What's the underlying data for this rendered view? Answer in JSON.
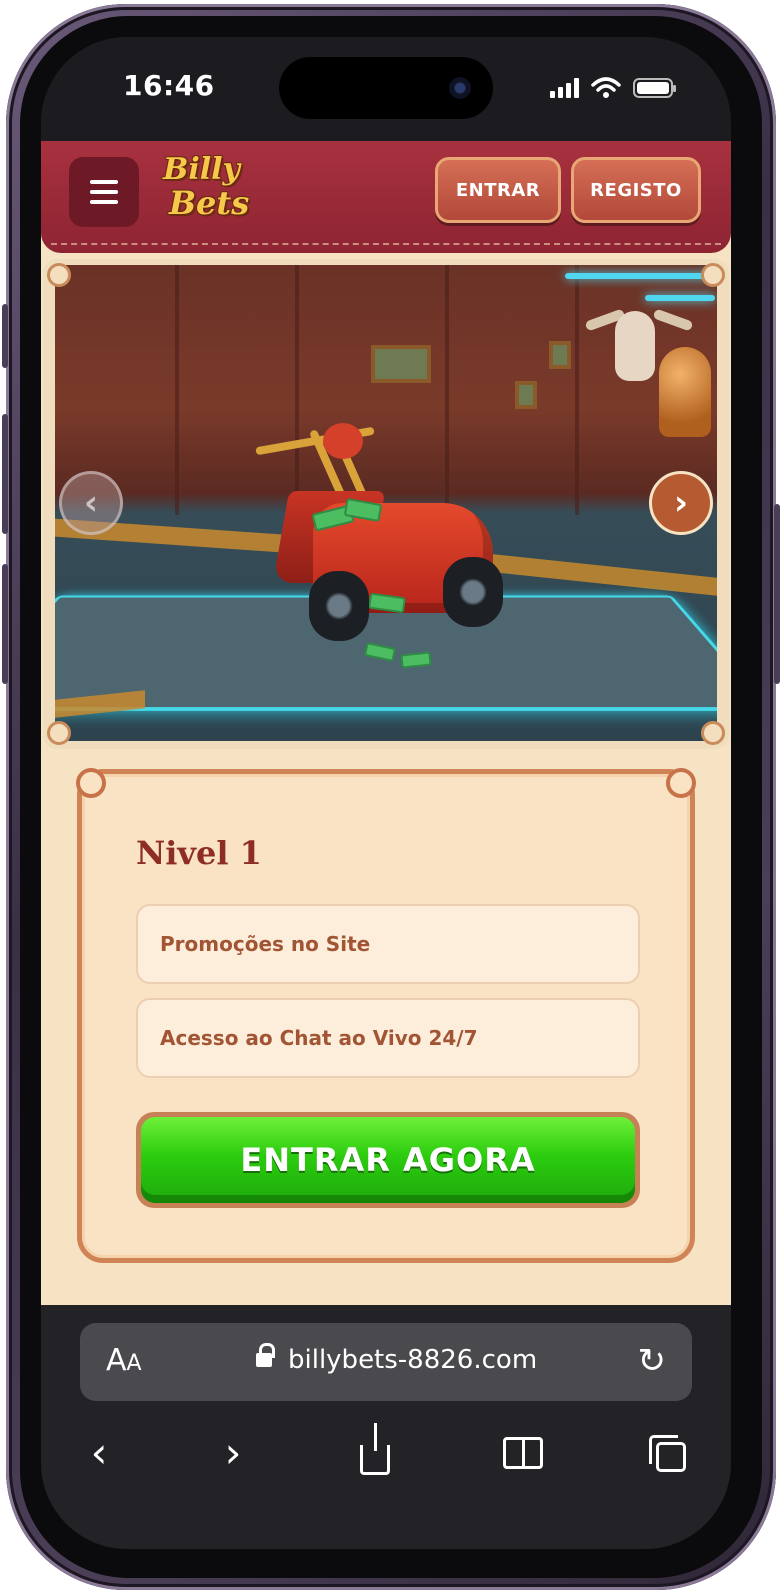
{
  "status_bar": {
    "time": "16:46"
  },
  "header": {
    "logo_line1": "Billy",
    "logo_line2": "Bets",
    "login_label": "ENTRAR",
    "register_label": "REGISTO"
  },
  "banner": {
    "prev_symbol": "‹",
    "next_symbol": "›"
  },
  "card": {
    "title": "Nivel 1",
    "benefits": [
      "Promoções no Site",
      "Acesso ao Chat ao Vivo 24/7"
    ],
    "cta_label": "ENTRAR AGORA"
  },
  "browser": {
    "text_size_big": "A",
    "text_size_small": "A",
    "url": "billybets-8826.com",
    "reload_symbol": "↻",
    "back_symbol": "‹",
    "forward_symbol": "›"
  },
  "colors": {
    "header_red": "#a8313f",
    "page_cream": "#f6e3c3",
    "cta_green": "#2ccc0e",
    "card_border": "#d08355"
  },
  "icons": [
    "menu-icon",
    "lock-icon",
    "reload-icon",
    "back-icon",
    "forward-icon",
    "share-icon",
    "bookmarks-icon",
    "tabs-icon",
    "signal-icon",
    "wifi-icon",
    "battery-icon"
  ]
}
